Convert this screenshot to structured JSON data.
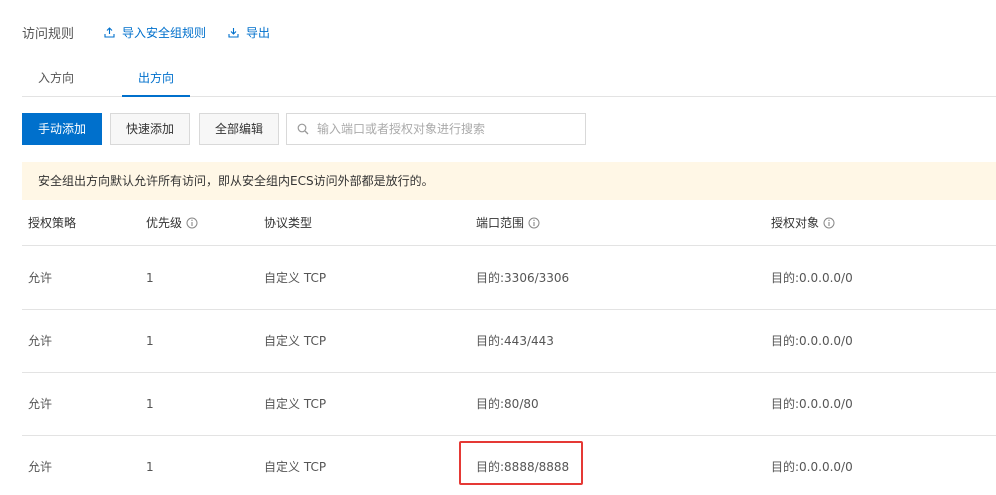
{
  "header": {
    "title": "访问规则",
    "import_label": "导入安全组规则",
    "export_label": "导出"
  },
  "tabs": [
    {
      "label": "入方向",
      "active": false
    },
    {
      "label": "出方向",
      "active": true
    }
  ],
  "toolbar": {
    "manual_add_label": "手动添加",
    "quick_add_label": "快速添加",
    "edit_all_label": "全部编辑",
    "search_placeholder": "输入端口或者授权对象进行搜索"
  },
  "notice": {
    "text": "安全组出方向默认允许所有访问，即从安全组内ECS访问外部都是放行的。"
  },
  "table": {
    "columns": [
      "授权策略",
      "优先级",
      "协议类型",
      "端口范围",
      "授权对象"
    ],
    "rows": [
      {
        "policy": "允许",
        "priority": "1",
        "protocol": "自定义 TCP",
        "port": "目的:3306/3306",
        "target": "目的:0.0.0.0/0"
      },
      {
        "policy": "允许",
        "priority": "1",
        "protocol": "自定义 TCP",
        "port": "目的:443/443",
        "target": "目的:0.0.0.0/0"
      },
      {
        "policy": "允许",
        "priority": "1",
        "protocol": "自定义 TCP",
        "port": "目的:80/80",
        "target": "目的:0.0.0.0/0"
      },
      {
        "policy": "允许",
        "priority": "1",
        "protocol": "自定义 TCP",
        "port": "目的:8888/8888",
        "target": "目的:0.0.0.0/0"
      }
    ]
  },
  "colors": {
    "accent": "#0070cc",
    "notice_bg": "#fff7e6",
    "highlight": "#e53935",
    "border": "#e3e3e3"
  },
  "icons": {
    "import": "upload-icon",
    "export": "download-icon",
    "search": "search-icon",
    "info": "info-icon"
  }
}
